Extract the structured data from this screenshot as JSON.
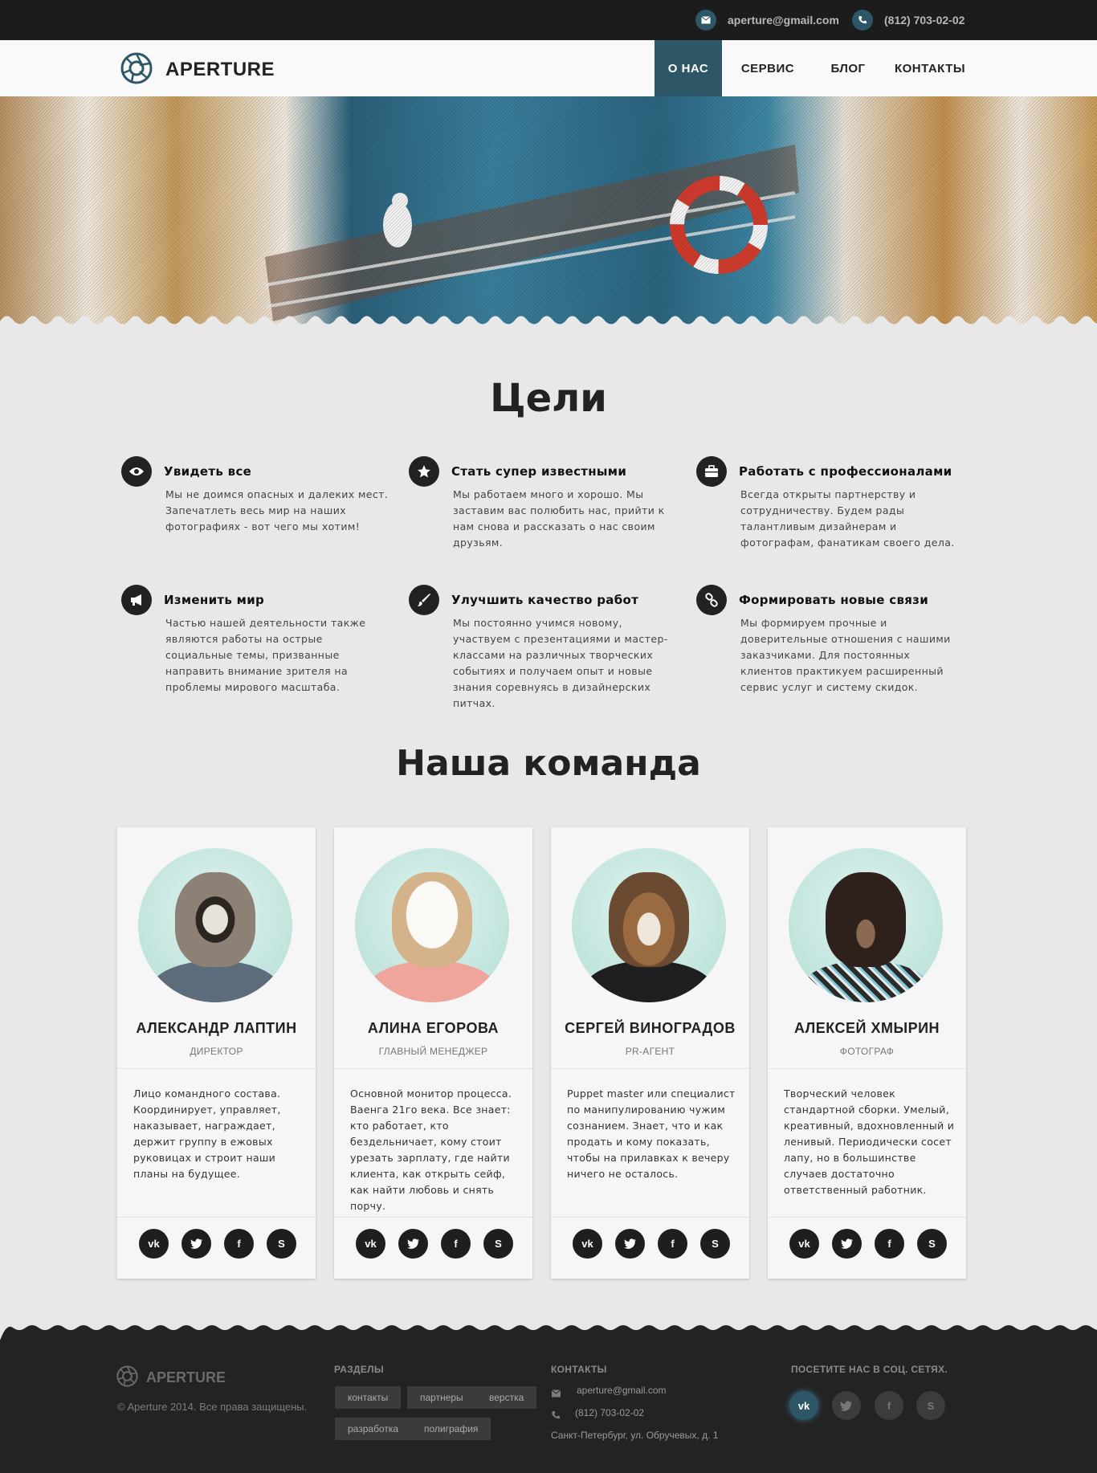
{
  "topbar": {
    "email": "aperture@gmail.com",
    "phone": "(812) 703-02-02"
  },
  "brand": {
    "name": "APERTURE",
    "accent": "#2d5666"
  },
  "nav": {
    "items": [
      "О НАС",
      "СЕРВИС",
      "БЛОГ",
      "КОНТАКТЫ"
    ],
    "active": "О НАС"
  },
  "goals": {
    "title": "Цели",
    "items": [
      {
        "icon": "eye-icon",
        "title": "Увидеть все",
        "text": "Мы не доимся опасных и далеких мест. Запечатлеть весь мир на наших фотографиях - вот чего мы хотим!"
      },
      {
        "icon": "star-icon",
        "title": "Стать супер известными",
        "text": "Мы работаем много и хорошо. Мы заставим вас полюбить нас, прийти к нам снова и рассказать о нас своим друзьям."
      },
      {
        "icon": "briefcase-icon",
        "title": "Работать с профессионалами",
        "text": "Всегда открыты партнерству и сотрудничеству. Будем рады талантливым дизайнерам и фотографам, фанатикам своего дела."
      },
      {
        "icon": "megaphone-icon",
        "title": "Изменить мир",
        "text": "Частью нашей деятельности также являются работы на острые социальные темы, призванные направить внимание зрителя на проблемы мирового масштаба."
      },
      {
        "icon": "brush-icon",
        "title": "Улучшить качество работ",
        "text": "Мы постоянно учимся новому, участвуем с презентациями и мастер-классами на различных творческих событиях и получаем опыт и новые знания соревнуясь в дизайнерских питчах."
      },
      {
        "icon": "link-icon",
        "title": "Формировать новые связи",
        "text": "Мы формируем прочные и доверительные отношения с нашими заказчиками. Для постоянных клиентов практикуем расширенный сервис услуг и систему скидок."
      }
    ]
  },
  "team": {
    "title": "Наша команда",
    "members": [
      {
        "name": "АЛЕКСАНДР ЛАПТИН",
        "role": "ДИРЕКТОР",
        "avatar": "raccoon",
        "text": "Лицо командного состава. Координирует, управляет, наказывает, награждает, держит группу в ежовых руковицах и строит наши планы на будущее."
      },
      {
        "name": "АЛИНА ЕГОРОВА",
        "role": "ГЛАВНЫЙ МЕНЕДЖЕР",
        "avatar": "owl",
        "text": "Основной монитор процесса. Ваенга 21го века. Все знает: кто работает, кто бездельничает, кому стоит урезать зарплату, где найти клиента, как открыть сейф, как найти любовь и снять порчу."
      },
      {
        "name": "СЕРГЕЙ ВИНОГРАДОВ",
        "role": "PR-АГЕНТ",
        "avatar": "wolf",
        "text": "Puppet master или специалист по манипулированию чужим сознанием. Знает, что и как продать и кому показать, чтобы на прилавках к вечеру ничего не осталось."
      },
      {
        "name": "АЛЕКСЕЙ ХМЫРИН",
        "role": "ФОТОГРАФ",
        "avatar": "bear",
        "text": "Творческий человек стандартной сборки. Умелый, креативный, вдохновленный и ленивый. Периодически сосет лапу, но в большинстве случаев достаточно ответственный работник."
      }
    ],
    "socials": [
      "vk-icon",
      "twitter-icon",
      "facebook-icon",
      "skype-icon"
    ]
  },
  "footer": {
    "brand": "APERTURE",
    "copyright": "© Aperture 2014. Все права защищены.",
    "sections_title": "РАЗДЕЛЫ",
    "tags": [
      "контакты",
      "партнеры",
      "верстка",
      "разработка",
      "полиграфия"
    ],
    "contacts_title": "КОНТАКТЫ",
    "email": "aperture@gmail.com",
    "phone": "(812) 703-02-02",
    "address": "Санкт-Петербург, ул. Обручевых, д. 1",
    "social_title": "ПОСЕТИТЕ НАС В СОЦ. СЕТЯХ."
  }
}
